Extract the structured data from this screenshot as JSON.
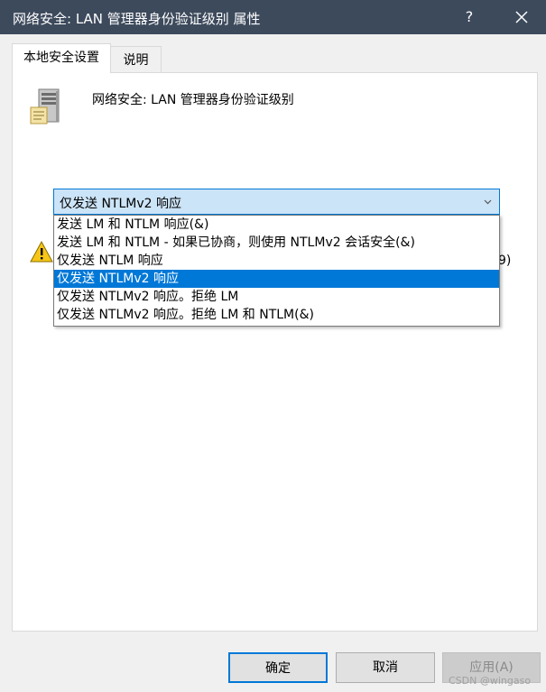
{
  "window": {
    "title": "网络安全: LAN 管理器身份验证级别 属性",
    "help_label": "?"
  },
  "tabs": [
    {
      "label": "本地安全设置",
      "active": true
    },
    {
      "label": "说明",
      "active": false
    }
  ],
  "policy": {
    "name": "网络安全: LAN 管理器身份验证级别",
    "icon": "server-icon"
  },
  "combo": {
    "selected_value": "仅发送 NTLMv2 响应",
    "options": [
      "发送 LM 和 NTLM 响应(&)",
      "发送 LM 和 NTLM - 如果已协商，则使用 NTLMv2 会话安全(&)",
      "仅发送 NTLM 响应",
      "仅发送 NTLMv2 响应",
      "仅发送 NTLMv2 响应。拒绝 LM",
      "仅发送 NTLMv2 响应。拒绝 LM 和 NTLM(&)"
    ],
    "highlighted_index": 3
  },
  "warning": {
    "clipped_text": "9)"
  },
  "buttons": {
    "ok": "确定",
    "cancel": "取消",
    "apply": "应用(A)"
  },
  "watermark": "CSDN @wingaso",
  "colors": {
    "titlebar": "#3d4a5c",
    "accent": "#0078d7",
    "combo_bg": "#cce4f7"
  }
}
